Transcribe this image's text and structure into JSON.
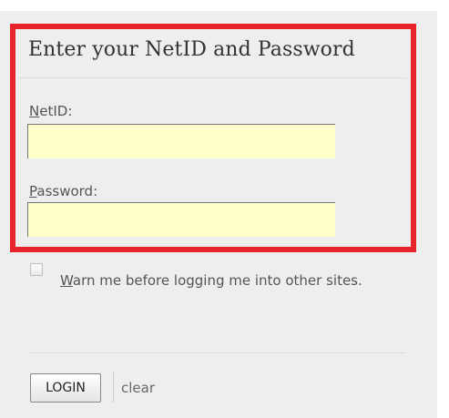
{
  "form": {
    "title": "Enter your NetID and Password",
    "highlight_color": "#e8232a",
    "field_background": "#ffffcc",
    "netid": {
      "label_accesskey": "N",
      "label_rest": "etID:",
      "value": ""
    },
    "password": {
      "label_accesskey": "P",
      "label_rest": "assword:",
      "value": ""
    },
    "warn": {
      "checked": false,
      "label_accesskey": "W",
      "label_rest": "arn me before logging me into other sites."
    },
    "login_label": "LOGIN",
    "clear_label": "clear"
  }
}
